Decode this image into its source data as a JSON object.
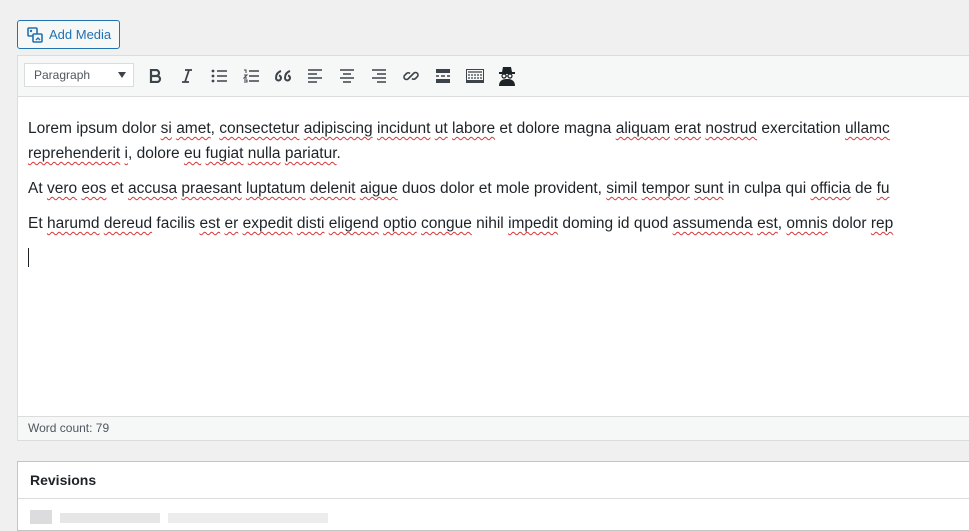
{
  "add_media": {
    "label": "Add Media",
    "icon": "add-media-icon"
  },
  "toolbar": {
    "format_select": "Paragraph",
    "buttons": [
      {
        "name": "bold-button",
        "icon": "bold-icon"
      },
      {
        "name": "italic-button",
        "icon": "italic-icon"
      },
      {
        "name": "bulleted-list-button",
        "icon": "bulleted-list-icon"
      },
      {
        "name": "numbered-list-button",
        "icon": "numbered-list-icon"
      },
      {
        "name": "blockquote-button",
        "icon": "blockquote-icon"
      },
      {
        "name": "align-left-button",
        "icon": "align-left-icon"
      },
      {
        "name": "align-center-button",
        "icon": "align-center-icon"
      },
      {
        "name": "align-right-button",
        "icon": "align-right-icon"
      },
      {
        "name": "insert-link-button",
        "icon": "link-icon"
      },
      {
        "name": "insert-read-more-button",
        "icon": "read-more-icon"
      },
      {
        "name": "toolbar-toggle-button",
        "icon": "toolbar-toggle-icon"
      },
      {
        "name": "spy-plugin-button",
        "icon": "spy-icon"
      }
    ]
  },
  "content": {
    "paragraphs": [
      "Lorem ipsum dolor si amet, consectetur adipiscing incidunt ut labore et dolore magna aliquam erat nostrud exercitation ullamc reprehenderit i, dolore eu fugiat nulla pariatur.",
      "At vero eos et accusa praesant luptatum delenit aigue duos dolor et mole provident, simil tempor sunt in culpa qui officia de fu",
      "Et harumd dereud facilis est er expedit disti eligend optio congue nihil impedit doming id quod assumenda est, omnis dolor rep"
    ],
    "p1_segments": [
      "Lorem ipsum dolor ",
      "si",
      " ",
      "amet",
      ", ",
      "consectetur",
      " ",
      "adipiscing",
      " ",
      "incidunt",
      " ",
      "ut",
      " ",
      "labore",
      " et dolore magna ",
      "aliquam",
      " ",
      "erat",
      " ",
      "nostrud",
      " exercitation ",
      "ullamc"
    ],
    "p1_line2": [
      "reprehenderit",
      " ",
      "i",
      ", dolore ",
      "eu",
      " ",
      "fugiat",
      " ",
      "nulla",
      " ",
      "pariatur",
      "."
    ],
    "p2_segments": [
      "At ",
      "vero",
      " ",
      "eos",
      " et ",
      "accusa",
      " ",
      "praesant",
      " ",
      "luptatum",
      " ",
      "delenit",
      " ",
      "aigue",
      " duos dolor et mole provident, ",
      "simil",
      " ",
      "tempor",
      " ",
      "sunt",
      " in culpa qui ",
      "officia",
      " de ",
      "fu"
    ],
    "p3_segments": [
      "Et ",
      "harumd",
      " ",
      "dereud",
      " facilis ",
      "est",
      " ",
      "er",
      " ",
      "expedit",
      " ",
      "disti",
      " ",
      "eligend",
      " ",
      "optio",
      " ",
      "congue",
      " nihil ",
      "impedit",
      " doming id quod ",
      "assumenda",
      " ",
      "est",
      ", ",
      "omnis",
      " dolor ",
      "rep"
    ]
  },
  "status_bar": {
    "word_count": "Word count: 79"
  },
  "revisions": {
    "title": "Revisions"
  },
  "colors": {
    "accent": "#2271b1",
    "spellcheck": "#d63638"
  }
}
